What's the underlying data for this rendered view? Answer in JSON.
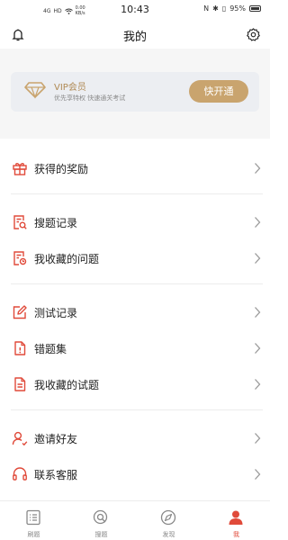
{
  "status_bar": {
    "time": "10:43",
    "network": "4G",
    "hd": "HD",
    "speed": "0.00",
    "speed_unit": "KB/s",
    "battery": "95%"
  },
  "header": {
    "title": "我的",
    "left_icon": "bell-icon",
    "right_icon": "gear-icon"
  },
  "vip": {
    "title": "VIP会员",
    "subtitle": "优先享特权 快速通关考试",
    "button": "快开通",
    "colors": {
      "accent": "#c9a46e",
      "title": "#b08a55",
      "card_bg": "#eceef2"
    }
  },
  "menu": {
    "items": [
      {
        "label": "获得的奖励",
        "icon": "gift-icon"
      },
      {
        "label": "搜题记录",
        "icon": "search-record-icon"
      },
      {
        "label": "我收藏的问题",
        "icon": "favorite-question-icon"
      },
      {
        "label": "测试记录",
        "icon": "edit-icon"
      },
      {
        "label": "错题集",
        "icon": "wrong-question-icon"
      },
      {
        "label": "我收藏的试题",
        "icon": "favorite-exam-icon"
      },
      {
        "label": "邀请好友",
        "icon": "invite-friend-icon"
      },
      {
        "label": "联系客服",
        "icon": "headset-icon"
      }
    ],
    "icon_color": "#e04a3a"
  },
  "tabbar": {
    "tabs": [
      {
        "label": "刷题",
        "icon": "practice-icon"
      },
      {
        "label": "搜题",
        "icon": "search-icon"
      },
      {
        "label": "发现",
        "icon": "compass-icon"
      },
      {
        "label": "我",
        "icon": "profile-icon",
        "active": true
      }
    ],
    "active_color": "#e04a3a"
  }
}
